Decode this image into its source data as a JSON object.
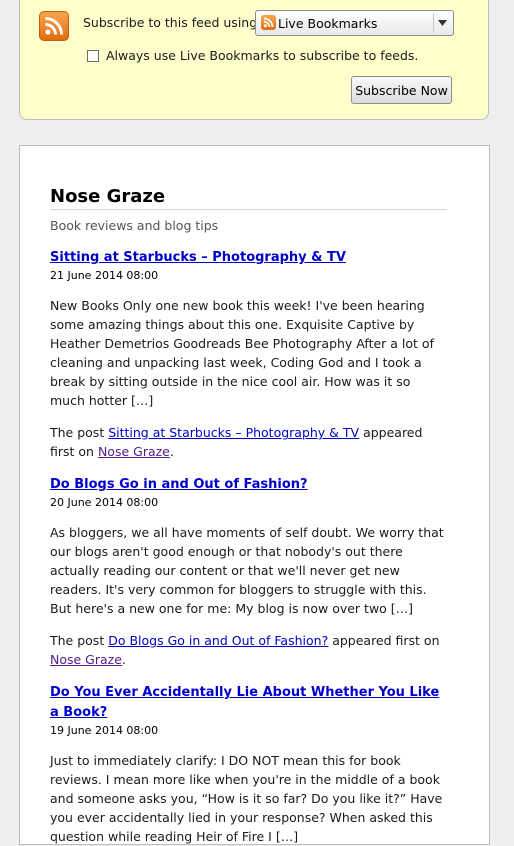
{
  "subscribe": {
    "label": "Subscribe to this feed using",
    "selected_reader": "Live Bookmarks",
    "always_use_label": "Always use Live Bookmarks to subscribe to feeds.",
    "always_use_checked": false,
    "button_label": "Subscribe Now"
  },
  "feed": {
    "title": "Nose Graze",
    "subtitle": "Book reviews and blog tips",
    "entries": [
      {
        "title": "Sitting at Starbucks – Photography & TV",
        "date": "21 June 2014 08:00",
        "body": "New Books Only one new book this week! I've been hearing some amazing things about this one. Exquisite Captive by Heather Demetrios Goodreads Bee Photography After a lot of cleaning and unpacking last week, Coding God and I took a break by sitting outside in the nice cool air. How was it so much hotter […]",
        "footer_prefix": "The post ",
        "footer_link": "Sitting at Starbucks – Photography & TV",
        "footer_middle": " appeared first on ",
        "footer_site": "Nose Graze",
        "footer_end": "."
      },
      {
        "title": "Do Blogs Go in and Out of Fashion?",
        "date": "20 June 2014 08:00",
        "body": "As bloggers, we all have moments of self doubt. We worry that our blogs aren't good enough or that nobody's out there actually reading our content or that we'll never get new readers. It's very common for bloggers to struggle with this. But here's a new one for me: My blog is now over two […]",
        "footer_prefix": "The post ",
        "footer_link": "Do Blogs Go in and Out of Fashion?",
        "footer_middle": " appeared first on ",
        "footer_site": "Nose Graze",
        "footer_end": "."
      },
      {
        "title": "Do You Ever Accidentally Lie About Whether You Like a Book?",
        "date": "19 June 2014 08:00",
        "body": "Just to immediately clarify: I DO NOT mean this for book reviews. I mean more like when you're in the middle of a book and someone asks you, “How is it so far? Do you like it?” Have you ever accidentally lied in your response? When asked this question while reading Heir of Fire I […]"
      }
    ]
  },
  "icons": {
    "feed": "rss-feed-icon",
    "reader": "rss-feed-icon",
    "dropdown": "chevron-down-icon"
  },
  "colors": {
    "subscribe_background": "#ffffcc",
    "link": "#0000cc",
    "visited_link": "#551a8b",
    "rss_orange": "#f08a24"
  }
}
